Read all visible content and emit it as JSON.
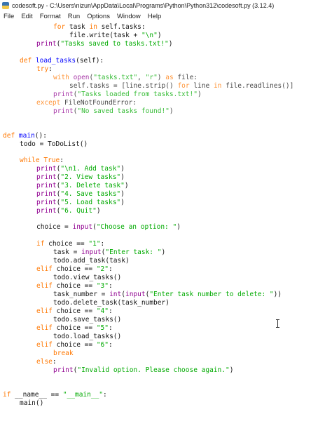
{
  "window": {
    "title": "codesoft.py - C:\\Users\\nizun\\AppData\\Local\\Programs\\Python\\Python312\\codesoft.py (3.12.4)"
  },
  "menu": [
    "File",
    "Edit",
    "Format",
    "Run",
    "Options",
    "Window",
    "Help"
  ],
  "code": {
    "l1": "for task in self.tasks:",
    "l2": "file.write(task + \"\\n\")",
    "l3": "print(\"Tasks saved to tasks.txt!\")",
    "l4": "def load_tasks(self):",
    "l5": "try:",
    "l6": "with open(\"tasks.txt\", \"r\") as file:",
    "l7": "self.tasks = [line.strip() for line in file.readlines()]",
    "l8": "print(\"Tasks loaded from tasks.txt!\")",
    "l9": "except FileNotFoundError:",
    "l10": "print(\"No saved tasks found!\")",
    "l11": "def main():",
    "l12": "todo = ToDoList()",
    "l13": "while True:",
    "l14": "print(\"\\n1. Add task\")",
    "l15": "print(\"2. View tasks\")",
    "l16": "print(\"3. Delete task\")",
    "l17": "print(\"4. Save tasks\")",
    "l18": "print(\"5. Load tasks\")",
    "l19": "print(\"6. Quit\")",
    "l20": "choice = input(\"Choose an option: \")",
    "l21": "if choice == \"1\":",
    "l22": "task = input(\"Enter task: \")",
    "l23": "todo.add_task(task)",
    "l24": "elif choice == \"2\":",
    "l25": "todo.view_tasks()",
    "l26": "elif choice == \"3\":",
    "l27": "task_number = int(input(\"Enter task number to delete: \"))",
    "l28": "todo.delete_task(task_number)",
    "l29": "elif choice == \"4\":",
    "l30": "todo.save_tasks()",
    "l31": "elif choice == \"5\":",
    "l32": "todo.load_tasks()",
    "l33": "elif choice == \"6\":",
    "l34": "break",
    "l35": "else:",
    "l36": "print(\"Invalid option. Please choose again.\")",
    "l37": "if __name__ == \"__main__\":",
    "l38": "main()"
  }
}
